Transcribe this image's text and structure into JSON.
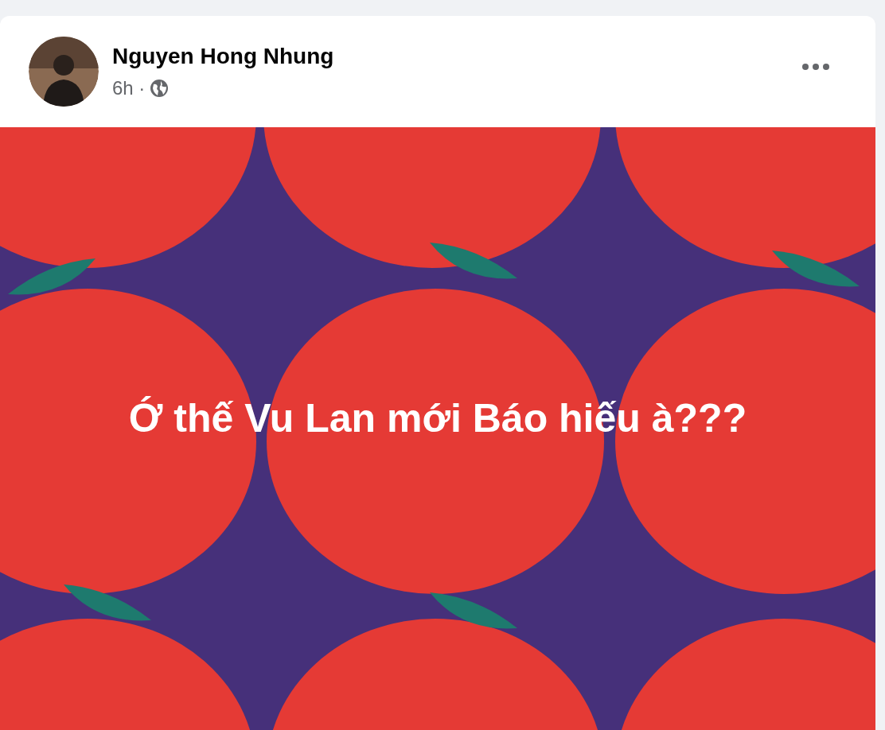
{
  "post": {
    "author": "Nguyen Hong Nhung",
    "time": "6h ·",
    "text": "Ớ thế Vu Lan mới Báo hiếu à???"
  }
}
